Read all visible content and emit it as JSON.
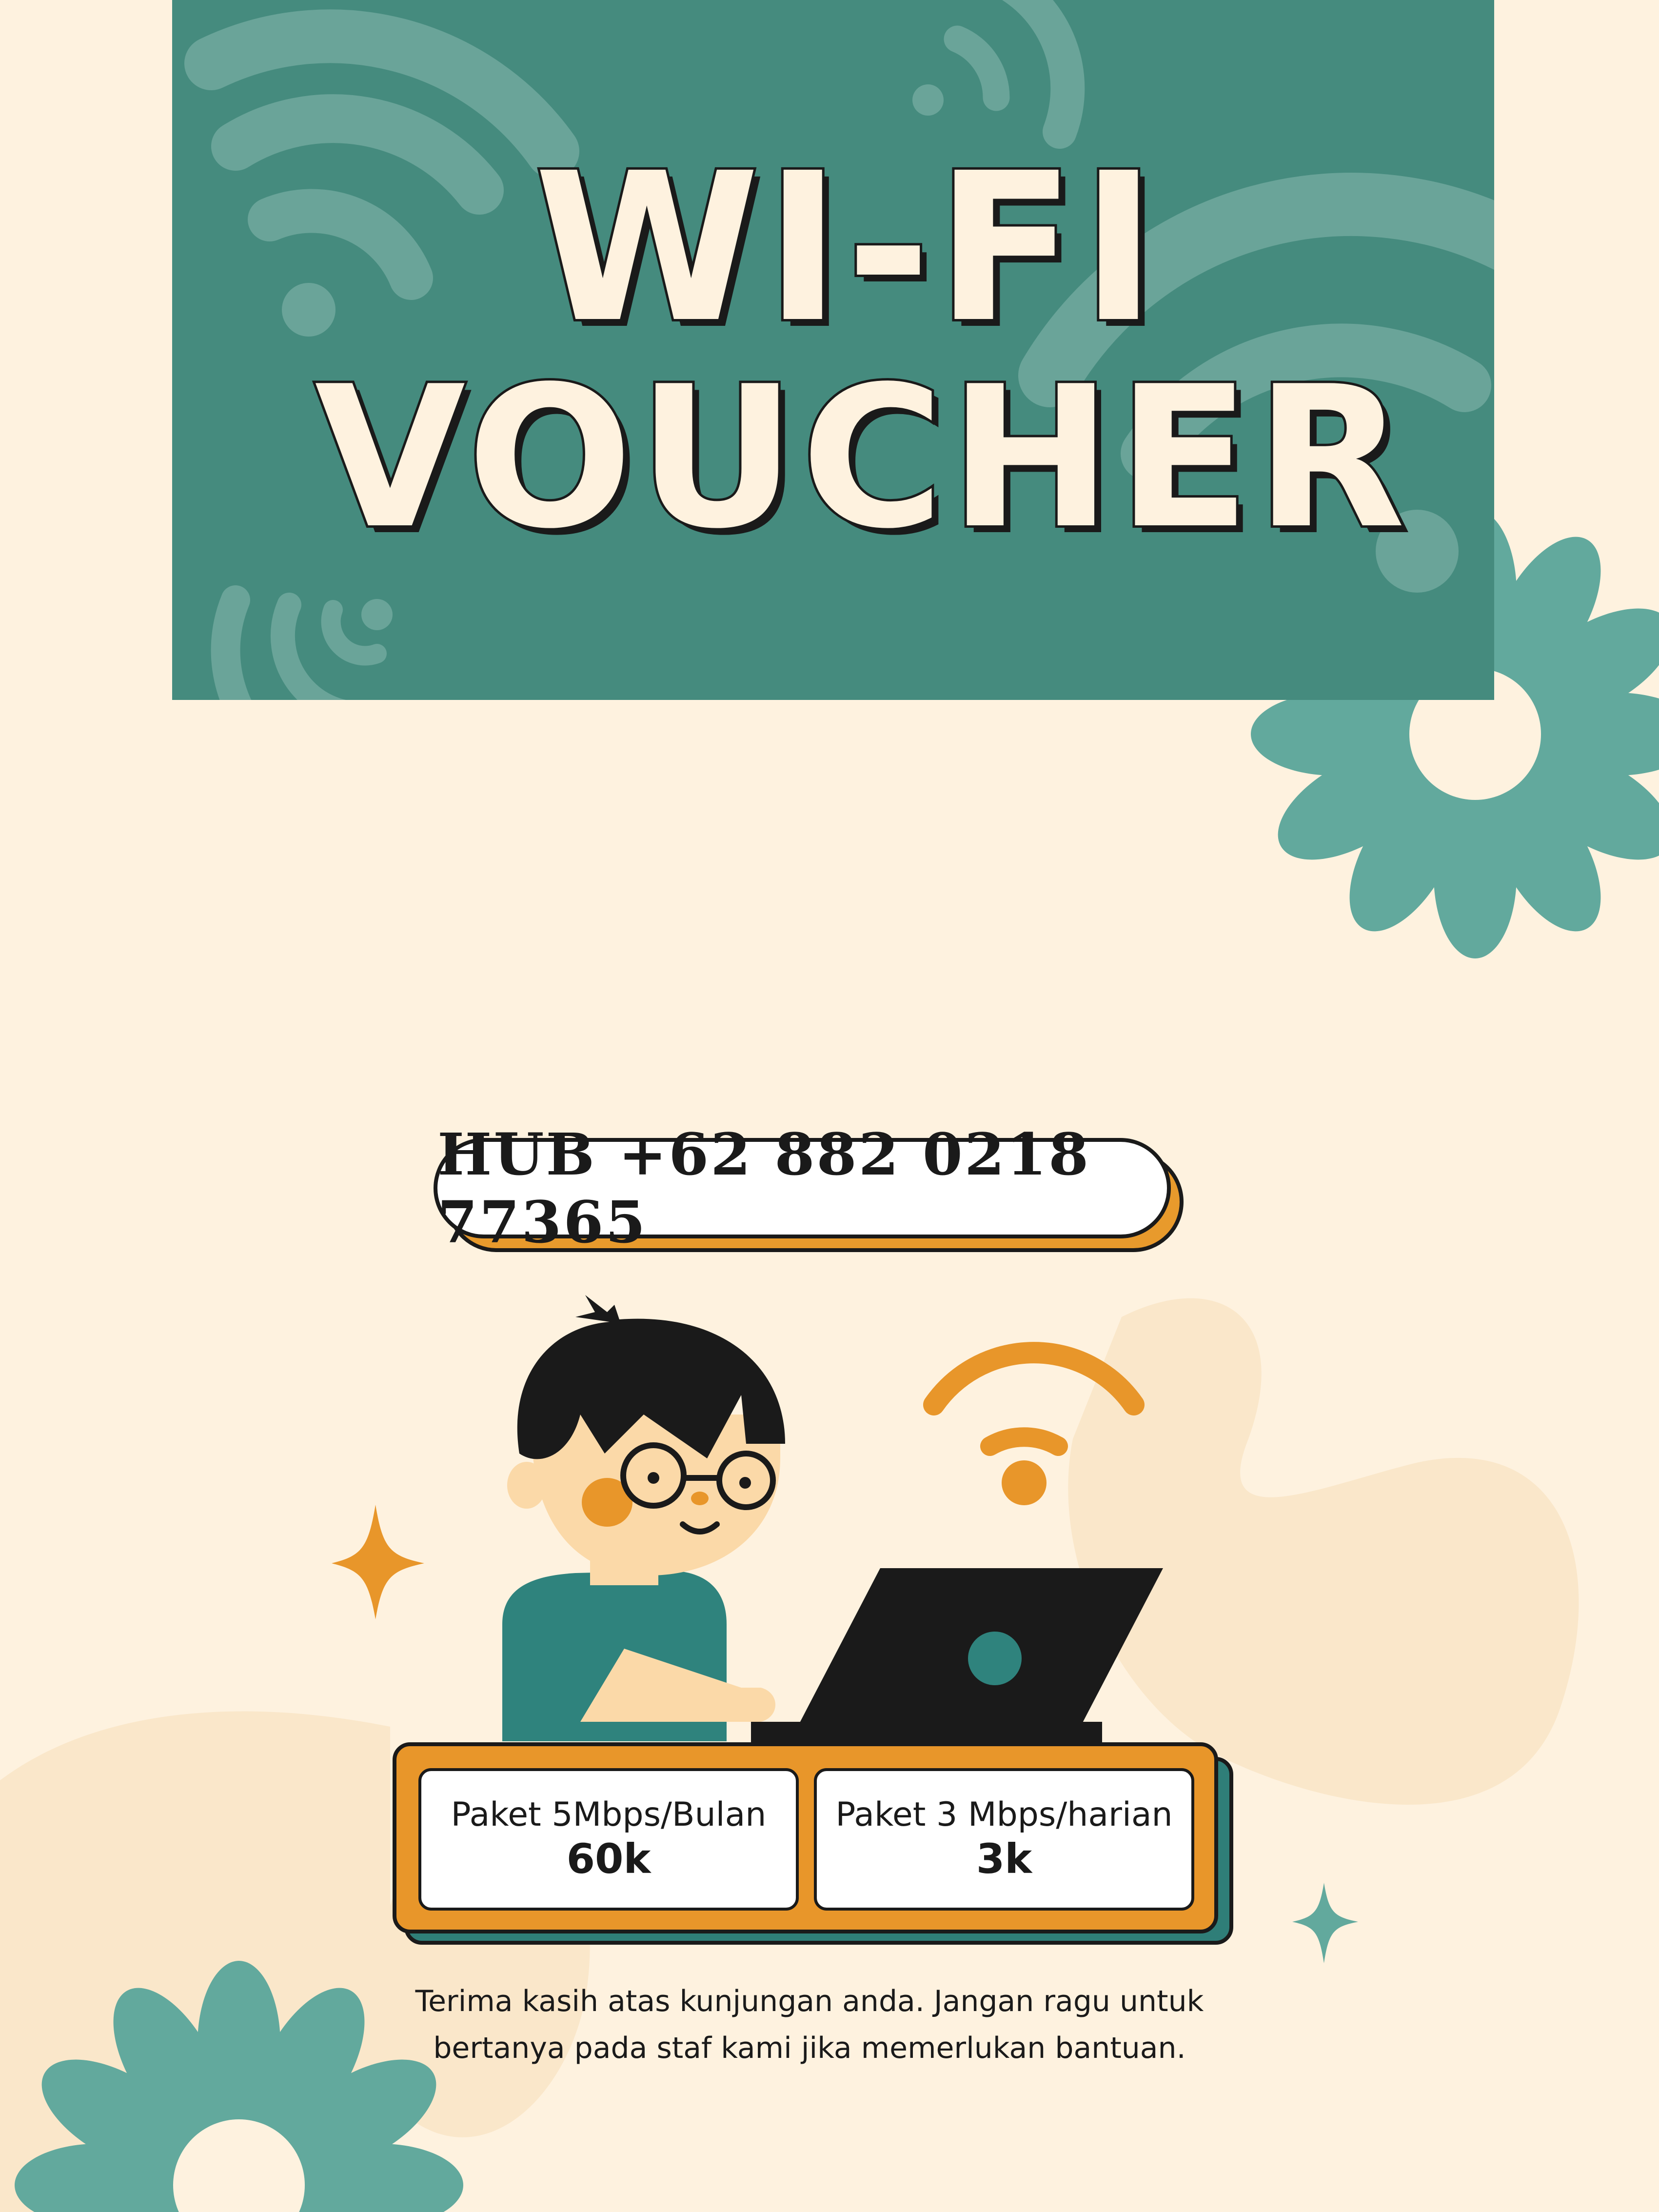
{
  "title": {
    "line1": "WI-FI",
    "line2": "VOUCHER"
  },
  "contact": {
    "text": "HUB +62 882 0218 77365"
  },
  "packages": [
    {
      "name": "Paket 5Mbps/Bulan",
      "price": "60k"
    },
    {
      "name": "Paket 3 Mbps/harian",
      "price": "3k"
    }
  ],
  "footer": {
    "line1": "Terima kasih atas kunjungan anda. Jangan ragu untuk",
    "line2": "bertanya pada staf kami jika memerlukan bantuan."
  },
  "colors": {
    "background": "#FEF2DF",
    "banner": "#458B7E",
    "teal": "#62A99D",
    "orange": "#E8962A",
    "dark": "#1A1A1A"
  },
  "icons": [
    "wifi-icon",
    "flower-icon",
    "sparkle-icon",
    "laptop-icon"
  ]
}
